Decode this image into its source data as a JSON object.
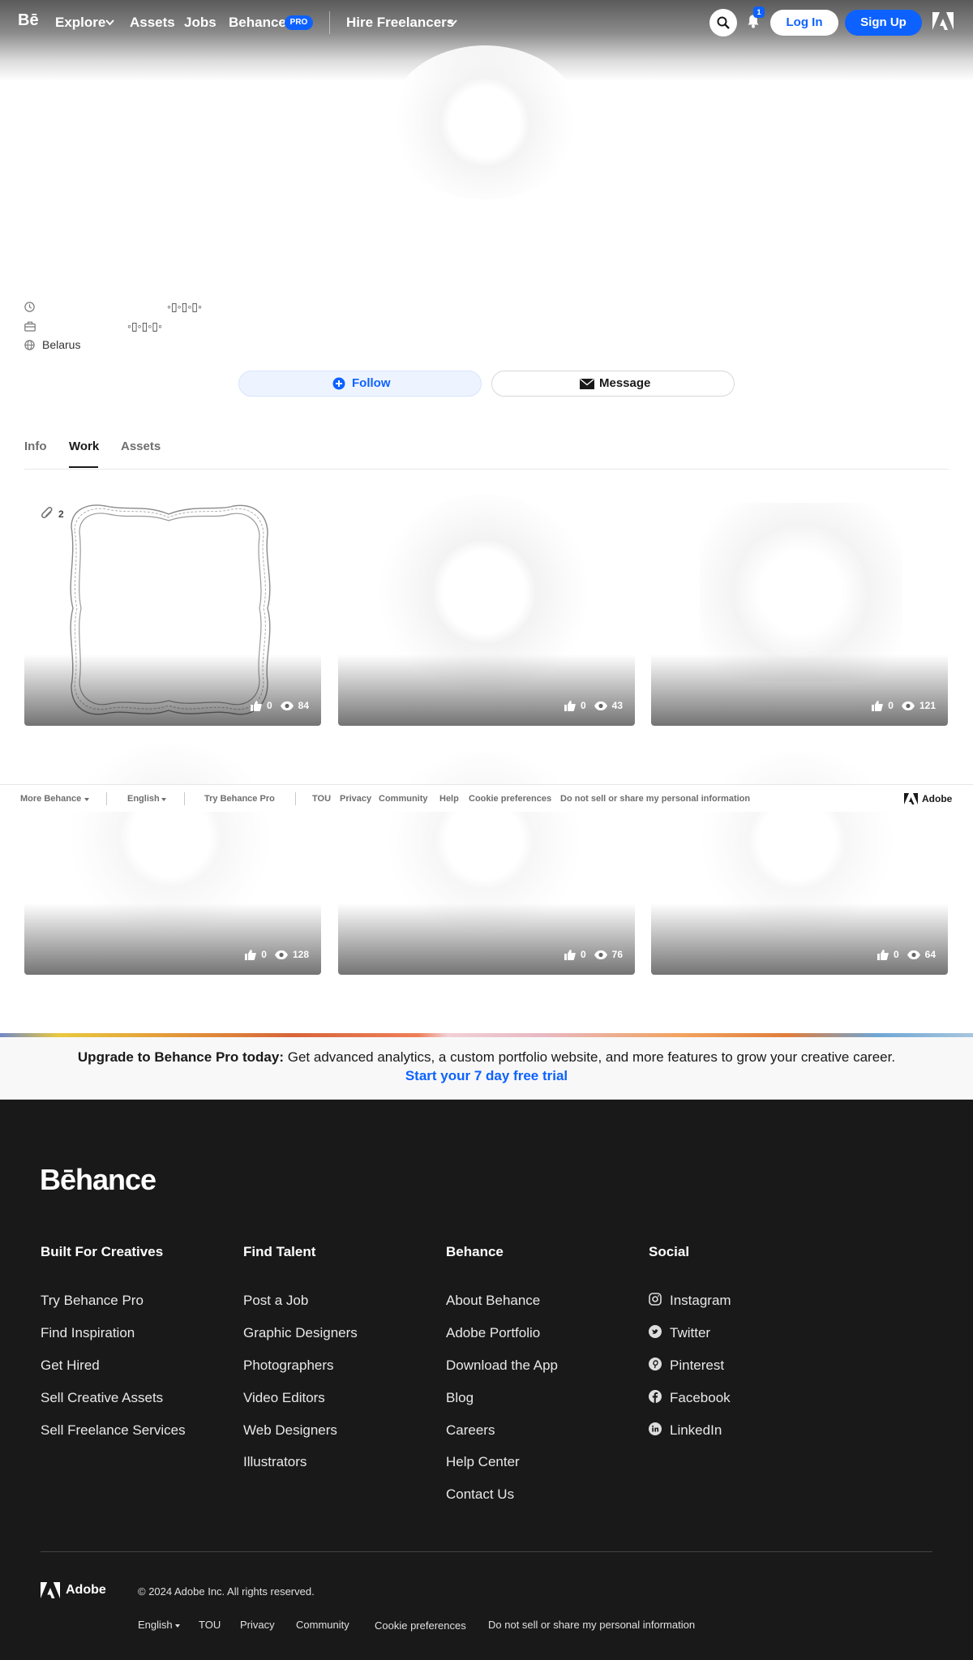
{
  "header": {
    "logo": "Bē",
    "nav": {
      "explore": "Explore",
      "assets": "Assets",
      "jobs": "Jobs",
      "behance": "Behance",
      "pro_badge": "PRO",
      "hire": "Hire Freelancers"
    },
    "notification_count": "1",
    "login": "Log In",
    "signup": "Sign Up"
  },
  "profile": {
    "info": {
      "line1": "◦▯◦▯◦▯◦",
      "line2": "◦▯◦▯◦▯◦",
      "location": "Belarus"
    },
    "follow": "Follow",
    "message": "Message"
  },
  "tabs": [
    "Info",
    "Work",
    "Assets"
  ],
  "active_tab": "Work",
  "projects": [
    {
      "attachments": "2",
      "likes": "0",
      "views": "84"
    },
    {
      "likes": "0",
      "views": "43"
    },
    {
      "likes": "0",
      "views": "121"
    },
    {
      "likes": "0",
      "views": "128"
    },
    {
      "likes": "0",
      "views": "76"
    },
    {
      "likes": "0",
      "views": "64"
    }
  ],
  "footer_bar": {
    "more": "More Behance",
    "language": "English",
    "try_pro": "Try Behance Pro",
    "links": [
      "TOU",
      "Privacy",
      "Community",
      "Help",
      "Cookie preferences",
      "Do not sell or share my personal information"
    ],
    "adobe": "Adobe"
  },
  "upgrade": {
    "bold": "Upgrade to Behance Pro today:",
    "text": "Get advanced analytics, a custom portfolio website, and more features to grow your creative career.",
    "cta": "Start your 7 day free trial"
  },
  "footer": {
    "logo": "Bēhance",
    "columns": [
      {
        "title": "Built For Creatives",
        "links": [
          "Try Behance Pro",
          "Find Inspiration",
          "Get Hired",
          "Sell Creative Assets",
          "Sell Freelance Services"
        ]
      },
      {
        "title": "Find Talent",
        "links": [
          "Post a Job",
          "Graphic Designers",
          "Photographers",
          "Video Editors",
          "Web Designers",
          "Illustrators"
        ]
      },
      {
        "title": "Behance",
        "links": [
          "About Behance",
          "Adobe Portfolio",
          "Download the App",
          "Blog",
          "Careers",
          "Help Center",
          "Contact Us"
        ]
      },
      {
        "title": "Social",
        "links": [
          "Instagram",
          "Twitter",
          "Pinterest",
          "Facebook",
          "LinkedIn"
        ]
      }
    ],
    "adobe": "Adobe",
    "copyright": "© 2024 Adobe Inc. All rights reserved.",
    "language": "English",
    "bottom_links": [
      "TOU",
      "Privacy",
      "Community",
      "Cookie preferences",
      "Do not sell or share my personal information"
    ]
  }
}
